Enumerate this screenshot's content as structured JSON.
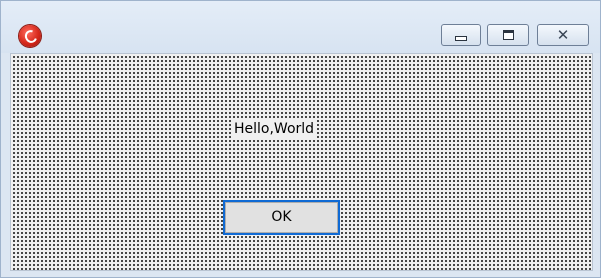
{
  "window": {
    "title_icon": "app-red-logo-icon",
    "controls": {
      "minimize_icon": "minimize-icon",
      "maximize_icon": "maximize-icon",
      "close_label": "✕"
    }
  },
  "content": {
    "label": "Hello,World",
    "ok_label": "OK"
  },
  "colors": {
    "titlebar": "#dce6f2",
    "client_background": "#f0f0f0",
    "grid_dots": "#1f1f1f",
    "focus_border": "#0f6ad4",
    "button_face": "#e1e1e1",
    "app_icon": "#d6281b"
  }
}
